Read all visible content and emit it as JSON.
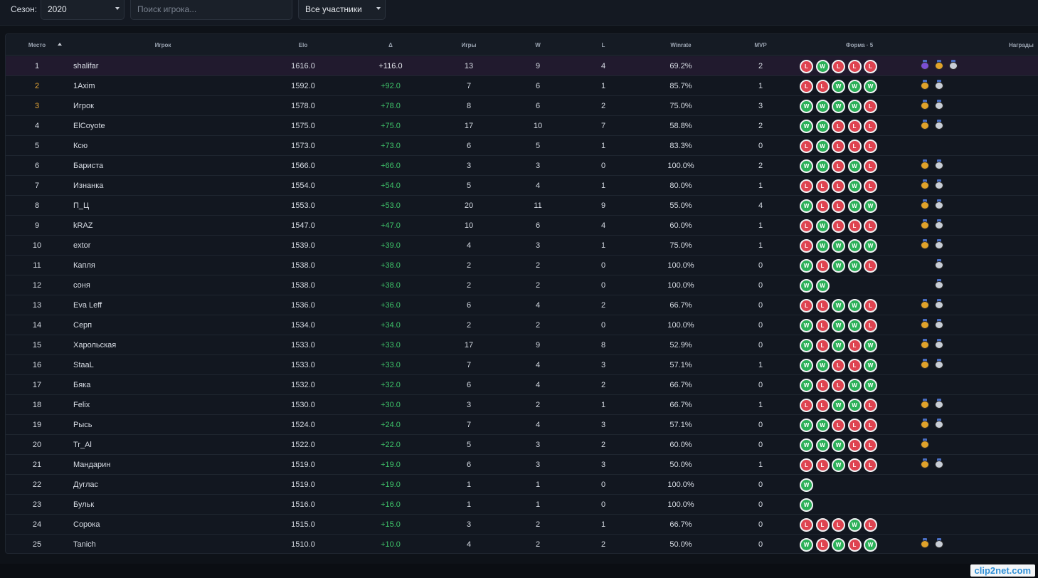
{
  "filters": {
    "season_label": "Сезон:",
    "season_value": "2020",
    "search_placeholder": "Поиск игрока...",
    "participants_value": "Все участники"
  },
  "columns": {
    "place": "Место",
    "player": "Игрок",
    "elo": "Elo",
    "delta": "Δ",
    "games": "Игры",
    "wins": "W",
    "losses": "L",
    "winrate": "Winrate",
    "mvp": "MVP",
    "form": "Форма · 5",
    "awards": "Награды"
  },
  "rows": [
    {
      "place": "1",
      "player": "shalifar",
      "elo": "1616.0",
      "delta": "+116.0",
      "games": "13",
      "w": "9",
      "l": "4",
      "winrate": "69.2%",
      "mvp": "2",
      "form": [
        "L",
        "W",
        "L",
        "L",
        "L"
      ],
      "awards": [
        "trophy",
        "gold",
        "silver"
      ]
    },
    {
      "place": "2",
      "player": "1Axim",
      "elo": "1592.0",
      "delta": "+92.0",
      "games": "7",
      "w": "6",
      "l": "1",
      "winrate": "85.7%",
      "mvp": "1",
      "form": [
        "L",
        "L",
        "W",
        "W",
        "W"
      ],
      "awards": [
        "gold",
        "silver"
      ]
    },
    {
      "place": "3",
      "player": "Игрок",
      "elo": "1578.0",
      "delta": "+78.0",
      "games": "8",
      "w": "6",
      "l": "2",
      "winrate": "75.0%",
      "mvp": "3",
      "form": [
        "W",
        "W",
        "W",
        "W",
        "L"
      ],
      "awards": [
        "gold",
        "silver"
      ]
    },
    {
      "place": "4",
      "player": "ElCoyote",
      "elo": "1575.0",
      "delta": "+75.0",
      "games": "17",
      "w": "10",
      "l": "7",
      "winrate": "58.8%",
      "mvp": "2",
      "form": [
        "W",
        "W",
        "L",
        "L",
        "L"
      ],
      "awards": [
        "gold",
        "silver"
      ]
    },
    {
      "place": "5",
      "player": "Ксю",
      "elo": "1573.0",
      "delta": "+73.0",
      "games": "6",
      "w": "5",
      "l": "1",
      "winrate": "83.3%",
      "mvp": "0",
      "form": [
        "L",
        "W",
        "L",
        "L",
        "L"
      ],
      "awards": []
    },
    {
      "place": "6",
      "player": "Бариста",
      "elo": "1566.0",
      "delta": "+66.0",
      "games": "3",
      "w": "3",
      "l": "0",
      "winrate": "100.0%",
      "mvp": "2",
      "form": [
        "W",
        "W",
        "L",
        "W",
        "L"
      ],
      "awards": [
        "gold",
        "silver"
      ]
    },
    {
      "place": "7",
      "player": "Изнанка",
      "elo": "1554.0",
      "delta": "+54.0",
      "games": "5",
      "w": "4",
      "l": "1",
      "winrate": "80.0%",
      "mvp": "1",
      "form": [
        "L",
        "L",
        "L",
        "W",
        "L"
      ],
      "awards": [
        "gold",
        "silver"
      ]
    },
    {
      "place": "8",
      "player": "П_Ц",
      "elo": "1553.0",
      "delta": "+53.0",
      "games": "20",
      "w": "11",
      "l": "9",
      "winrate": "55.0%",
      "mvp": "4",
      "form": [
        "W",
        "L",
        "L",
        "W",
        "W"
      ],
      "awards": [
        "gold",
        "silver"
      ]
    },
    {
      "place": "9",
      "player": "kRAZ",
      "elo": "1547.0",
      "delta": "+47.0",
      "games": "10",
      "w": "6",
      "l": "4",
      "winrate": "60.0%",
      "mvp": "1",
      "form": [
        "L",
        "W",
        "L",
        "L",
        "L"
      ],
      "awards": [
        "gold",
        "silver"
      ]
    },
    {
      "place": "10",
      "player": "extor",
      "elo": "1539.0",
      "delta": "+39.0",
      "games": "4",
      "w": "3",
      "l": "1",
      "winrate": "75.0%",
      "mvp": "1",
      "form": [
        "L",
        "W",
        "W",
        "W",
        "W"
      ],
      "awards": [
        "gold",
        "silver"
      ]
    },
    {
      "place": "11",
      "player": "Капля",
      "elo": "1538.0",
      "delta": "+38.0",
      "games": "2",
      "w": "2",
      "l": "0",
      "winrate": "100.0%",
      "mvp": "0",
      "form": [
        "W",
        "L",
        "W",
        "W",
        "L"
      ],
      "awards": [
        "silver"
      ]
    },
    {
      "place": "12",
      "player": "соня",
      "elo": "1538.0",
      "delta": "+38.0",
      "games": "2",
      "w": "2",
      "l": "0",
      "winrate": "100.0%",
      "mvp": "0",
      "form": [
        "W",
        "W"
      ],
      "awards": [
        "silver"
      ]
    },
    {
      "place": "13",
      "player": "Eva Leff",
      "elo": "1536.0",
      "delta": "+36.0",
      "games": "6",
      "w": "4",
      "l": "2",
      "winrate": "66.7%",
      "mvp": "0",
      "form": [
        "L",
        "L",
        "W",
        "W",
        "L"
      ],
      "awards": [
        "gold",
        "silver"
      ]
    },
    {
      "place": "14",
      "player": "Серп",
      "elo": "1534.0",
      "delta": "+34.0",
      "games": "2",
      "w": "2",
      "l": "0",
      "winrate": "100.0%",
      "mvp": "0",
      "form": [
        "W",
        "L",
        "W",
        "W",
        "L"
      ],
      "awards": [
        "gold",
        "silver"
      ]
    },
    {
      "place": "15",
      "player": "Харольская",
      "elo": "1533.0",
      "delta": "+33.0",
      "games": "17",
      "w": "9",
      "l": "8",
      "winrate": "52.9%",
      "mvp": "0",
      "form": [
        "W",
        "L",
        "W",
        "L",
        "W"
      ],
      "awards": [
        "gold",
        "silver"
      ]
    },
    {
      "place": "16",
      "player": "StaaL",
      "elo": "1533.0",
      "delta": "+33.0",
      "games": "7",
      "w": "4",
      "l": "3",
      "winrate": "57.1%",
      "mvp": "1",
      "form": [
        "W",
        "W",
        "L",
        "L",
        "W"
      ],
      "awards": [
        "gold",
        "silver"
      ]
    },
    {
      "place": "17",
      "player": "Бяка",
      "elo": "1532.0",
      "delta": "+32.0",
      "games": "6",
      "w": "4",
      "l": "2",
      "winrate": "66.7%",
      "mvp": "0",
      "form": [
        "W",
        "L",
        "L",
        "W",
        "W"
      ],
      "awards": []
    },
    {
      "place": "18",
      "player": "Felix",
      "elo": "1530.0",
      "delta": "+30.0",
      "games": "3",
      "w": "2",
      "l": "1",
      "winrate": "66.7%",
      "mvp": "1",
      "form": [
        "L",
        "L",
        "W",
        "W",
        "L"
      ],
      "awards": [
        "gold",
        "silver"
      ]
    },
    {
      "place": "19",
      "player": "Рысь",
      "elo": "1524.0",
      "delta": "+24.0",
      "games": "7",
      "w": "4",
      "l": "3",
      "winrate": "57.1%",
      "mvp": "0",
      "form": [
        "W",
        "W",
        "L",
        "L",
        "L"
      ],
      "awards": [
        "gold",
        "silver"
      ]
    },
    {
      "place": "20",
      "player": "Tr_Al",
      "elo": "1522.0",
      "delta": "+22.0",
      "games": "5",
      "w": "3",
      "l": "2",
      "winrate": "60.0%",
      "mvp": "0",
      "form": [
        "W",
        "W",
        "W",
        "L",
        "L"
      ],
      "awards": [
        "gold"
      ]
    },
    {
      "place": "21",
      "player": "Мандарин",
      "elo": "1519.0",
      "delta": "+19.0",
      "games": "6",
      "w": "3",
      "l": "3",
      "winrate": "50.0%",
      "mvp": "1",
      "form": [
        "L",
        "L",
        "W",
        "L",
        "L"
      ],
      "awards": [
        "gold",
        "silver"
      ]
    },
    {
      "place": "22",
      "player": "Дуглас",
      "elo": "1519.0",
      "delta": "+19.0",
      "games": "1",
      "w": "1",
      "l": "0",
      "winrate": "100.0%",
      "mvp": "0",
      "form": [
        "W"
      ],
      "awards": []
    },
    {
      "place": "23",
      "player": "Бульк",
      "elo": "1516.0",
      "delta": "+16.0",
      "games": "1",
      "w": "1",
      "l": "0",
      "winrate": "100.0%",
      "mvp": "0",
      "form": [
        "W"
      ],
      "awards": []
    },
    {
      "place": "24",
      "player": "Сорока",
      "elo": "1515.0",
      "delta": "+15.0",
      "games": "3",
      "w": "2",
      "l": "1",
      "winrate": "66.7%",
      "mvp": "0",
      "form": [
        "L",
        "L",
        "L",
        "W",
        "L"
      ],
      "awards": []
    },
    {
      "place": "25",
      "player": "Tanich",
      "elo": "1510.0",
      "delta": "+10.0",
      "games": "4",
      "w": "2",
      "l": "2",
      "winrate": "50.0%",
      "mvp": "0",
      "form": [
        "W",
        "L",
        "W",
        "L",
        "W"
      ],
      "awards": [
        "gold",
        "silver"
      ]
    }
  ],
  "colors": {
    "win": "#2bb058",
    "loss": "#de4350",
    "delta_positive": "#3fc36a",
    "place_highlight": "#e5a637",
    "first_row_bg": "#211a2e"
  },
  "watermark": "clip2net.com"
}
